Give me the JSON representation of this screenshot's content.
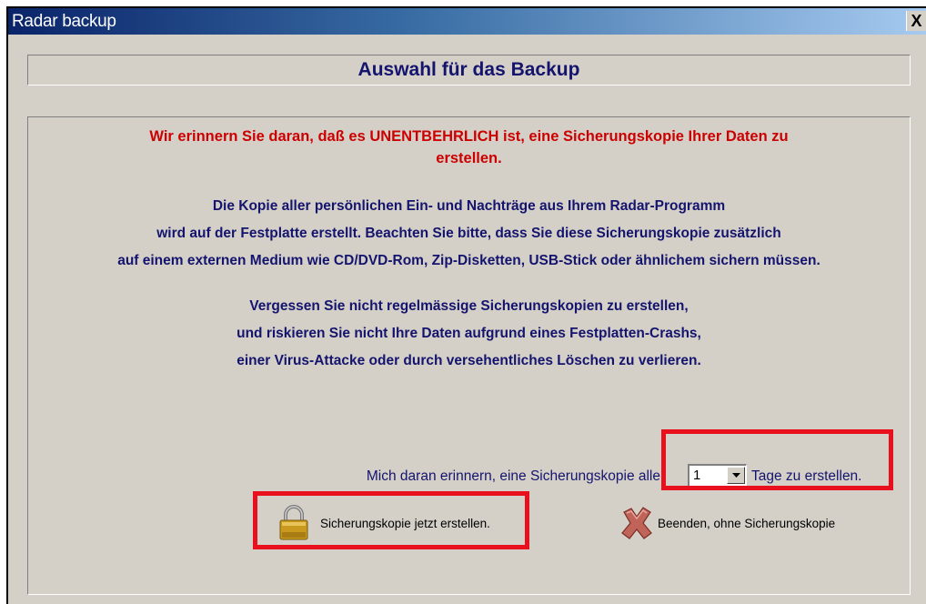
{
  "window": {
    "title": "Radar backup",
    "close_label": "X"
  },
  "header": {
    "title": "Auswahl für das Backup"
  },
  "warning": {
    "line1": "Wir erinnern Sie daran, daß es UNENTBEHRLICH ist, eine Sicherungskopie Ihrer Daten zu",
    "line2": "erstellen."
  },
  "info": {
    "lines": [
      "Die Kopie aller persönlichen Ein- und Nachträge aus Ihrem Radar-Programm",
      "wird auf der Festplatte erstellt. Beachten Sie bitte, dass Sie diese Sicherungskopie zusätzlich",
      "auf einem externen Medium wie CD/DVD-Rom, Zip-Disketten, USB-Stick oder ähnlichem sichern müssen."
    ]
  },
  "reminder_text": {
    "lines": [
      "Vergessen Sie nicht regelmässige Sicherungskopien zu erstellen,",
      "und riskieren Sie nicht Ihre Daten aufgrund eines Festplatten-Crashs,",
      "einer Virus-Attacke oder durch versehentliches Löschen zu verlieren."
    ]
  },
  "remind": {
    "label": "Mich daran erinnern, eine Sicherungskopie alle",
    "selected": "1",
    "suffix": "Tage zu erstellen."
  },
  "buttons": {
    "backup_label": "Sicherungskopie jetzt erstellen.",
    "exit_label": "Beenden, ohne Sicherungskopie"
  },
  "colors": {
    "warning": "#cc0000",
    "text": "#14146e",
    "highlight": "#e8101c",
    "face": "#d4d0c8"
  },
  "icons": {
    "backup": "padlock-icon",
    "exit": "red-x-icon",
    "dropdown": "chevron-down-icon"
  }
}
